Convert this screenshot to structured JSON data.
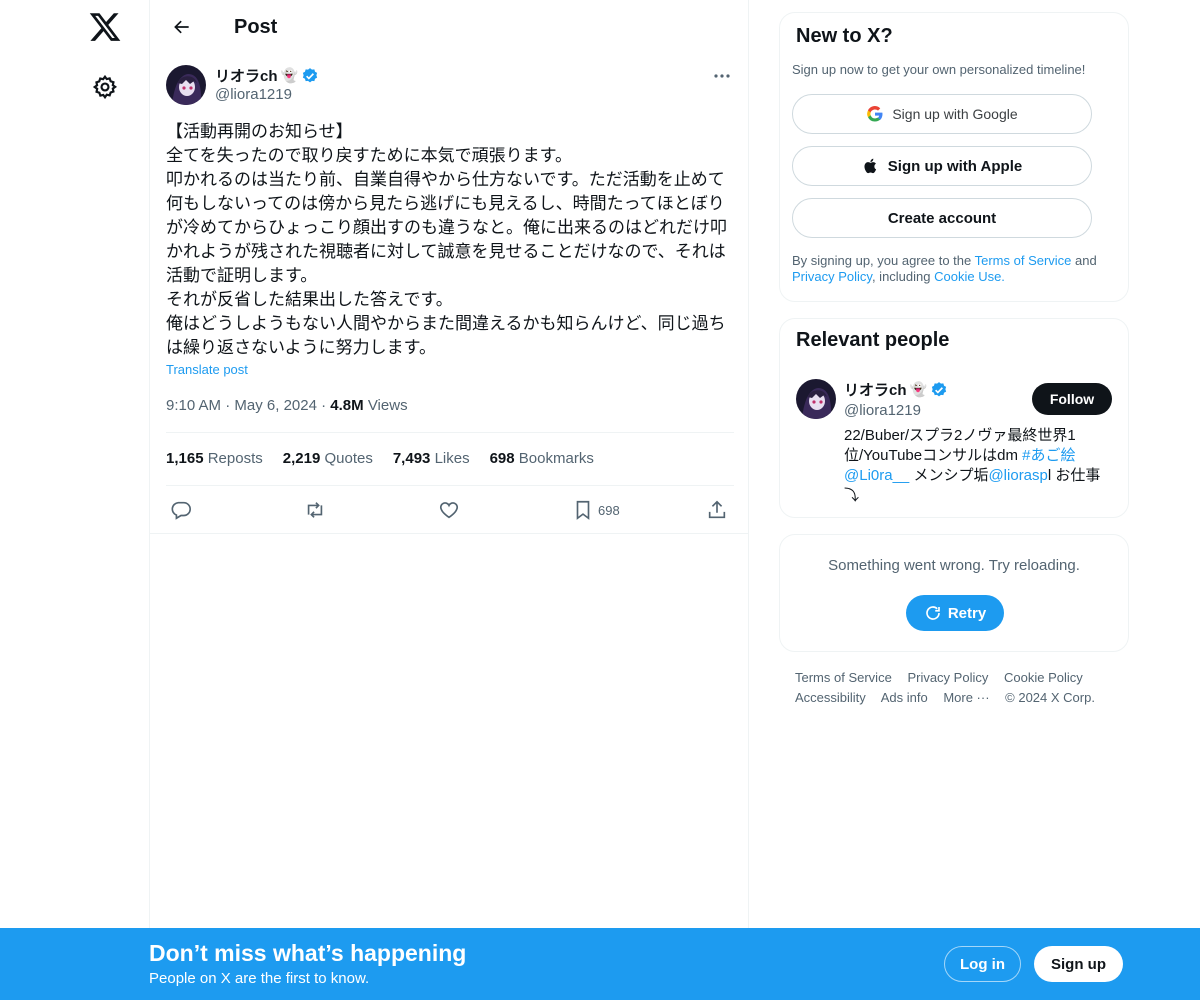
{
  "header": {
    "title": "Post"
  },
  "tweet": {
    "author_name": "リオラch",
    "author_handle": "@liora1219",
    "emoji": "👻",
    "body": "【活動再開のお知らせ】\n全てを失ったので取り戻すために本気で頑張ります。\n叩かれるのは当たり前、自業自得やから仕方ないです。ただ活動を止めて何もしないってのは傍から見たら逃げにも見えるし、時間たってほとぼりが冷めてからひょっこり顔出すのも違うなと。俺に出来るのはどれだけ叩かれようが残された視聴者に対して誠意を見せることだけなので、それは活動で証明します。\nそれが反省した結果出した答えです。\n俺はどうしようもない人間やからまた間違えるかも知らんけど、同じ過ちは繰り返さないように努力します。",
    "translate": "Translate post",
    "time": "9:10 AM",
    "date": "May 6, 2024",
    "views_count": "4.8M",
    "views_label": "Views",
    "reposts_count": "1,165",
    "reposts_label": "Reposts",
    "quotes_count": "2,219",
    "quotes_label": "Quotes",
    "likes_count": "7,493",
    "likes_label": "Likes",
    "bookmarks_count": "698",
    "bookmarks_label": "Bookmarks",
    "bookmark_action_count": "698"
  },
  "signup_card": {
    "title": "New to X?",
    "subtitle": "Sign up now to get your own personalized timeline!",
    "google": "Sign up with Google",
    "apple": "Sign up with Apple",
    "create": "Create account",
    "legal_prefix": "By signing up, you agree to the ",
    "tos": "Terms of Service",
    "and": " and ",
    "privacy": "Privacy Policy",
    "including": ", including ",
    "cookie": "Cookie Use."
  },
  "relevant": {
    "title": "Relevant people",
    "name": "リオラch",
    "handle": "@liora1219",
    "follow": "Follow",
    "bio_1": "22/Buber/スプラ2ノヴァ最終世界1位/YouTubeコンサルはdm ",
    "bio_tag": "#あご絵",
    "bio_mention1": "@Li0ra__",
    "bio_2": " メンシプ垢",
    "bio_mention2": "@liorasp",
    "bio_3": "l お仕事⤵︎"
  },
  "error_card": {
    "message": "Something went wrong. Try reloading.",
    "retry": "Retry"
  },
  "footer": {
    "links": [
      "Terms of Service",
      "Privacy Policy",
      "Cookie Policy",
      "Accessibility",
      "Ads info",
      "More ···",
      "© 2024 X Corp."
    ]
  },
  "banner": {
    "headline": "Don’t miss what’s happening",
    "sub": "People on X are the first to know.",
    "login": "Log in",
    "signup": "Sign up"
  },
  "colors": {
    "accent": "#1d9bf0",
    "text": "#0f1419",
    "muted": "#536471"
  }
}
